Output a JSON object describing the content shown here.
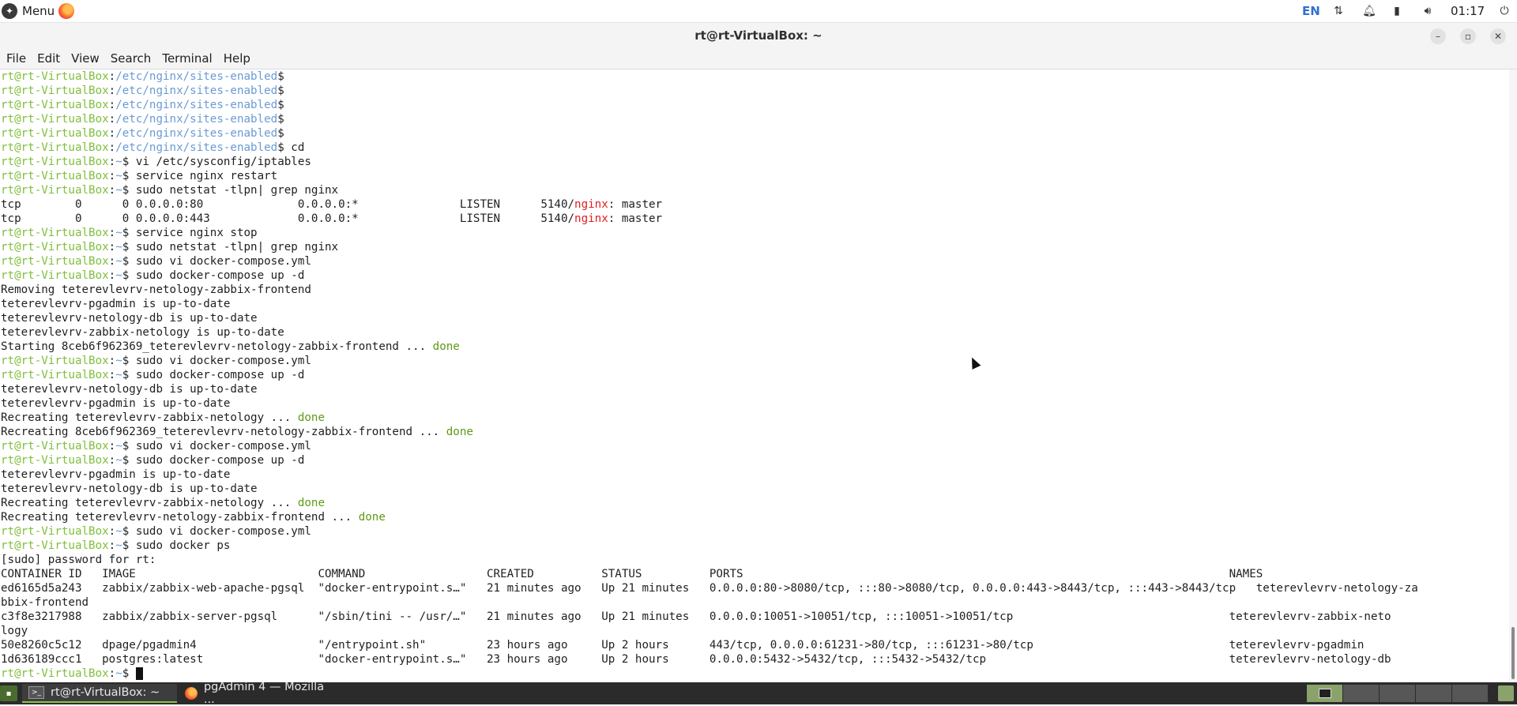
{
  "top_panel": {
    "menu_label": "Menu",
    "language": "EN",
    "clock": "01:17",
    "icons": [
      "menu-logo-icon",
      "firefox-icon",
      "network-icon",
      "bell-icon",
      "battery-icon",
      "volume-icon",
      "power-icon"
    ]
  },
  "window": {
    "title": "rt@rt-VirtualBox: ~",
    "buttons": {
      "minimize": "–",
      "maximize": "▫",
      "close": "✕"
    }
  },
  "menubar": [
    "File",
    "Edit",
    "View",
    "Search",
    "Terminal",
    "Help"
  ],
  "terminal": {
    "lines": [
      [
        [
          "u",
          "rt@rt-VirtualBox"
        ],
        [
          "n",
          ":"
        ],
        [
          "p",
          "/etc/nginx/sites-enabled"
        ],
        [
          "n",
          "$"
        ]
      ],
      [
        [
          "u",
          "rt@rt-VirtualBox"
        ],
        [
          "n",
          ":"
        ],
        [
          "p",
          "/etc/nginx/sites-enabled"
        ],
        [
          "n",
          "$"
        ]
      ],
      [
        [
          "u",
          "rt@rt-VirtualBox"
        ],
        [
          "n",
          ":"
        ],
        [
          "p",
          "/etc/nginx/sites-enabled"
        ],
        [
          "n",
          "$"
        ]
      ],
      [
        [
          "u",
          "rt@rt-VirtualBox"
        ],
        [
          "n",
          ":"
        ],
        [
          "p",
          "/etc/nginx/sites-enabled"
        ],
        [
          "n",
          "$"
        ]
      ],
      [
        [
          "u",
          "rt@rt-VirtualBox"
        ],
        [
          "n",
          ":"
        ],
        [
          "p",
          "/etc/nginx/sites-enabled"
        ],
        [
          "n",
          "$"
        ]
      ],
      [
        [
          "u",
          "rt@rt-VirtualBox"
        ],
        [
          "n",
          ":"
        ],
        [
          "p",
          "/etc/nginx/sites-enabled"
        ],
        [
          "n",
          "$ cd"
        ]
      ],
      [
        [
          "u",
          "rt@rt-VirtualBox"
        ],
        [
          "n",
          ":"
        ],
        [
          "p",
          "~"
        ],
        [
          "n",
          "$ vi /etc/sysconfig/iptables"
        ]
      ],
      [
        [
          "u",
          "rt@rt-VirtualBox"
        ],
        [
          "n",
          ":"
        ],
        [
          "p",
          "~"
        ],
        [
          "n",
          "$ service nginx restart"
        ]
      ],
      [
        [
          "u",
          "rt@rt-VirtualBox"
        ],
        [
          "n",
          ":"
        ],
        [
          "p",
          "~"
        ],
        [
          "n",
          "$ sudo netstat -tlpn| grep nginx"
        ]
      ],
      [
        [
          "n",
          "tcp        0      0 0.0.0.0:80              0.0.0.0:*               LISTEN      5140/"
        ],
        [
          "r",
          "nginx"
        ],
        [
          "n",
          ": master"
        ]
      ],
      [
        [
          "n",
          "tcp        0      0 0.0.0.0:443             0.0.0.0:*               LISTEN      5140/"
        ],
        [
          "r",
          "nginx"
        ],
        [
          "n",
          ": master"
        ]
      ],
      [
        [
          "u",
          "rt@rt-VirtualBox"
        ],
        [
          "n",
          ":"
        ],
        [
          "p",
          "~"
        ],
        [
          "n",
          "$ service nginx stop"
        ]
      ],
      [
        [
          "u",
          "rt@rt-VirtualBox"
        ],
        [
          "n",
          ":"
        ],
        [
          "p",
          "~"
        ],
        [
          "n",
          "$ sudo netstat -tlpn| grep nginx"
        ]
      ],
      [
        [
          "u",
          "rt@rt-VirtualBox"
        ],
        [
          "n",
          ":"
        ],
        [
          "p",
          "~"
        ],
        [
          "n",
          "$ sudo vi docker-compose.yml"
        ]
      ],
      [
        [
          "u",
          "rt@rt-VirtualBox"
        ],
        [
          "n",
          ":"
        ],
        [
          "p",
          "~"
        ],
        [
          "n",
          "$ sudo docker-compose up -d"
        ]
      ],
      [
        [
          "n",
          "Removing teterevlevrv-netology-zabbix-frontend"
        ]
      ],
      [
        [
          "n",
          "teterevlevrv-pgadmin is up-to-date"
        ]
      ],
      [
        [
          "n",
          "teterevlevrv-netology-db is up-to-date"
        ]
      ],
      [
        [
          "n",
          "teterevlevrv-zabbix-netology is up-to-date"
        ]
      ],
      [
        [
          "n",
          "Starting 8ceb6f962369_teterevlevrv-netology-zabbix-frontend ... "
        ],
        [
          "g",
          "done"
        ]
      ],
      [
        [
          "u",
          "rt@rt-VirtualBox"
        ],
        [
          "n",
          ":"
        ],
        [
          "p",
          "~"
        ],
        [
          "n",
          "$ sudo vi docker-compose.yml"
        ]
      ],
      [
        [
          "u",
          "rt@rt-VirtualBox"
        ],
        [
          "n",
          ":"
        ],
        [
          "p",
          "~"
        ],
        [
          "n",
          "$ sudo docker-compose up -d"
        ]
      ],
      [
        [
          "n",
          "teterevlevrv-netology-db is up-to-date"
        ]
      ],
      [
        [
          "n",
          "teterevlevrv-pgadmin is up-to-date"
        ]
      ],
      [
        [
          "n",
          "Recreating teterevlevrv-zabbix-netology ... "
        ],
        [
          "g",
          "done"
        ]
      ],
      [
        [
          "n",
          "Recreating 8ceb6f962369_teterevlevrv-netology-zabbix-frontend ... "
        ],
        [
          "g",
          "done"
        ]
      ],
      [
        [
          "u",
          "rt@rt-VirtualBox"
        ],
        [
          "n",
          ":"
        ],
        [
          "p",
          "~"
        ],
        [
          "n",
          "$ sudo vi docker-compose.yml"
        ]
      ],
      [
        [
          "u",
          "rt@rt-VirtualBox"
        ],
        [
          "n",
          ":"
        ],
        [
          "p",
          "~"
        ],
        [
          "n",
          "$ sudo docker-compose up -d"
        ]
      ],
      [
        [
          "n",
          "teterevlevrv-pgadmin is up-to-date"
        ]
      ],
      [
        [
          "n",
          "teterevlevrv-netology-db is up-to-date"
        ]
      ],
      [
        [
          "n",
          "Recreating teterevlevrv-zabbix-netology ... "
        ],
        [
          "g",
          "done"
        ]
      ],
      [
        [
          "n",
          "Recreating teterevlevrv-netology-zabbix-frontend ... "
        ],
        [
          "g",
          "done"
        ]
      ],
      [
        [
          "u",
          "rt@rt-VirtualBox"
        ],
        [
          "n",
          ":"
        ],
        [
          "p",
          "~"
        ],
        [
          "n",
          "$ sudo vi docker-compose.yml"
        ]
      ],
      [
        [
          "u",
          "rt@rt-VirtualBox"
        ],
        [
          "n",
          ":"
        ],
        [
          "p",
          "~"
        ],
        [
          "n",
          "$ sudo docker ps"
        ]
      ],
      [
        [
          "n",
          "[sudo] password for rt:"
        ]
      ],
      [
        [
          "n",
          "CONTAINER ID   IMAGE                           COMMAND                  CREATED          STATUS          PORTS                                                                        NAMES"
        ]
      ],
      [
        [
          "n",
          "ed6165d5a243   zabbix/zabbix-web-apache-pgsql  \"docker-entrypoint.s…\"   21 minutes ago   Up 21 minutes   0.0.0.0:80->8080/tcp, :::80->8080/tcp, 0.0.0.0:443->8443/tcp, :::443->8443/tcp   teterevlevrv-netology-za"
        ]
      ],
      [
        [
          "n",
          "bbix-frontend"
        ]
      ],
      [
        [
          "n",
          "c3f8e3217988   zabbix/zabbix-server-pgsql      \"/sbin/tini -- /usr/…\"   21 minutes ago   Up 21 minutes   0.0.0.0:10051->10051/tcp, :::10051->10051/tcp                                teterevlevrv-zabbix-neto"
        ]
      ],
      [
        [
          "n",
          "logy"
        ]
      ],
      [
        [
          "n",
          "50e8260c5c12   dpage/pgadmin4                  \"/entrypoint.sh\"         23 hours ago     Up 2 hours      443/tcp, 0.0.0.0:61231->80/tcp, :::61231->80/tcp                             teterevlevrv-pgadmin"
        ]
      ],
      [
        [
          "n",
          "1d636189ccc1   postgres:latest                 \"docker-entrypoint.s…\"   23 hours ago     Up 2 hours      0.0.0.0:5432->5432/tcp, :::5432->5432/tcp                                    teterevlevrv-netology-db"
        ]
      ],
      [
        [
          "u",
          "rt@rt-VirtualBox"
        ],
        [
          "n",
          ":"
        ],
        [
          "p",
          "~"
        ],
        [
          "n",
          "$ "
        ],
        [
          "c",
          ""
        ]
      ]
    ]
  },
  "taskbar": {
    "tasks": [
      {
        "label": "rt@rt-VirtualBox: ~",
        "icon": "terminal-icon"
      },
      {
        "label": "pgAdmin 4 — Mozilla ...",
        "icon": "firefox-icon"
      }
    ]
  },
  "colors": {
    "user_host": "#7fbf3c",
    "path": "#6a9ad4",
    "done": "#5f9a14",
    "nginx": "#e02020"
  }
}
